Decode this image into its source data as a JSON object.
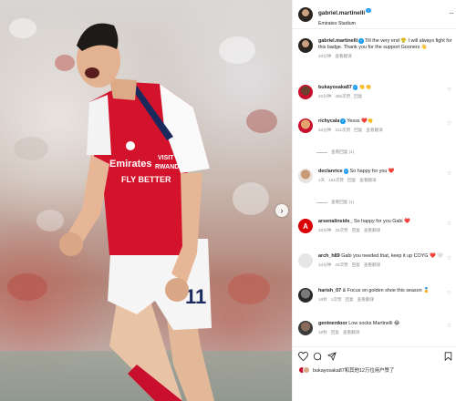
{
  "post": {
    "author": "gabriel.martinelli",
    "location": "Emirates Stadium",
    "caption": "Till the very end 😤 I will always fight for this badge. Thank you for the support Gooners 👋",
    "caption_time": "33分钟",
    "caption_translate": "查看翻译"
  },
  "comments": [
    {
      "user": "bukayosaka87",
      "text": "👏👏",
      "time": "32分钟",
      "likes": "468次赞",
      "reply": "回复"
    },
    {
      "user": "richycala",
      "text": "Yesss ❤️👏",
      "time": "33分钟",
      "likes": "312次赞",
      "reply": "回复",
      "translate": "查看翻译",
      "view_replies": "查看回复 (1)"
    },
    {
      "user": "declanrice",
      "text": "So happy for you ❤️",
      "time": "1天",
      "likes": "154次赞",
      "reply": "回复",
      "translate": "查看翻译",
      "view_replies": "查看回复 (1)"
    },
    {
      "user": "arsenalinside_",
      "text": "So happy for you Gabi ❤️",
      "time": "33分钟",
      "likes": "43次赞",
      "reply": "回复",
      "translate": "查看翻译"
    },
    {
      "user": "arch_h89",
      "text": "Gabi you needed that, keep it up COYG ❤️ 🤍",
      "time": "33分钟",
      "likes": "43次赞",
      "reply": "回复",
      "translate": "查看翻译"
    },
    {
      "user": "harish_07",
      "text": "& Focus on golden shoe this season 🏅",
      "time": "16秒",
      "likes": "1次赞",
      "reply": "回复",
      "translate": "查看翻译"
    },
    {
      "user": "gentnerdoor",
      "text": "Low socks Martinelli 😂",
      "time": "18秒",
      "likes": "",
      "reply": "回复",
      "translate": "查看翻译"
    }
  ],
  "likes_summary": "bukayosaka87和其他12万位用户赞了",
  "colors": {
    "red": "#db0007",
    "verified": "#1d9bf0"
  },
  "icons": [
    "heart-icon",
    "comment-icon",
    "share-icon",
    "bookmark-icon",
    "more-icon",
    "chevron-right-icon"
  ]
}
